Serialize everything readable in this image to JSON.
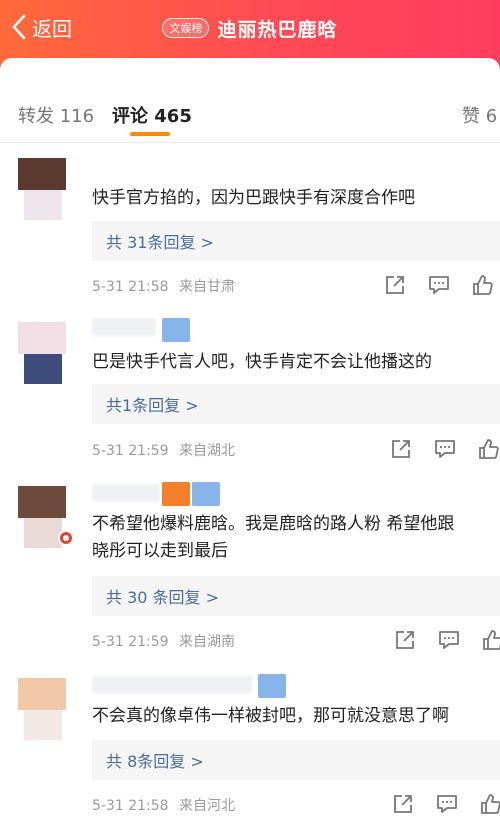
{
  "header": {
    "back_label": "返回",
    "topic_badge": "文娱榜",
    "title": "迪丽热巴鹿晗",
    "gradient_start": "#ff6a3a",
    "gradient_end": "#ff3d60"
  },
  "tabs": {
    "repost": "转发 116",
    "comment": "评论 465",
    "like": "赞 6",
    "active_color": "#ff8a00"
  },
  "comments": [
    {
      "text": "快手官方掐的，因为巴跟快手有深度合作吧",
      "reply": "共 31条回复 >",
      "time": "5-31 21:58",
      "location": "来自甘肃"
    },
    {
      "text": "巴是快手代言人吧，快手肯定不会让他播这的",
      "reply": "共1条回复 >",
      "time": "5-31 21:59",
      "location": "来自湖北"
    },
    {
      "text": "不希望他爆料鹿晗。我是鹿晗的路人粉 希望他跟",
      "text2": "晓彤可以走到最后",
      "reply": "共 30 条回复 >",
      "time": "5-31 21:59",
      "location": "来自湖南"
    },
    {
      "text": "不会真的像卓伟一样被封吧，那可就没意思了啊",
      "reply": "共 8条回复 >",
      "time": "5-31 21:58",
      "location": "来自河北"
    }
  ],
  "icons": {
    "back": "chevron-left-icon",
    "share": "share-icon",
    "comment": "comment-icon",
    "like": "thumbs-up-icon"
  },
  "link_color": "#4a6d9c"
}
